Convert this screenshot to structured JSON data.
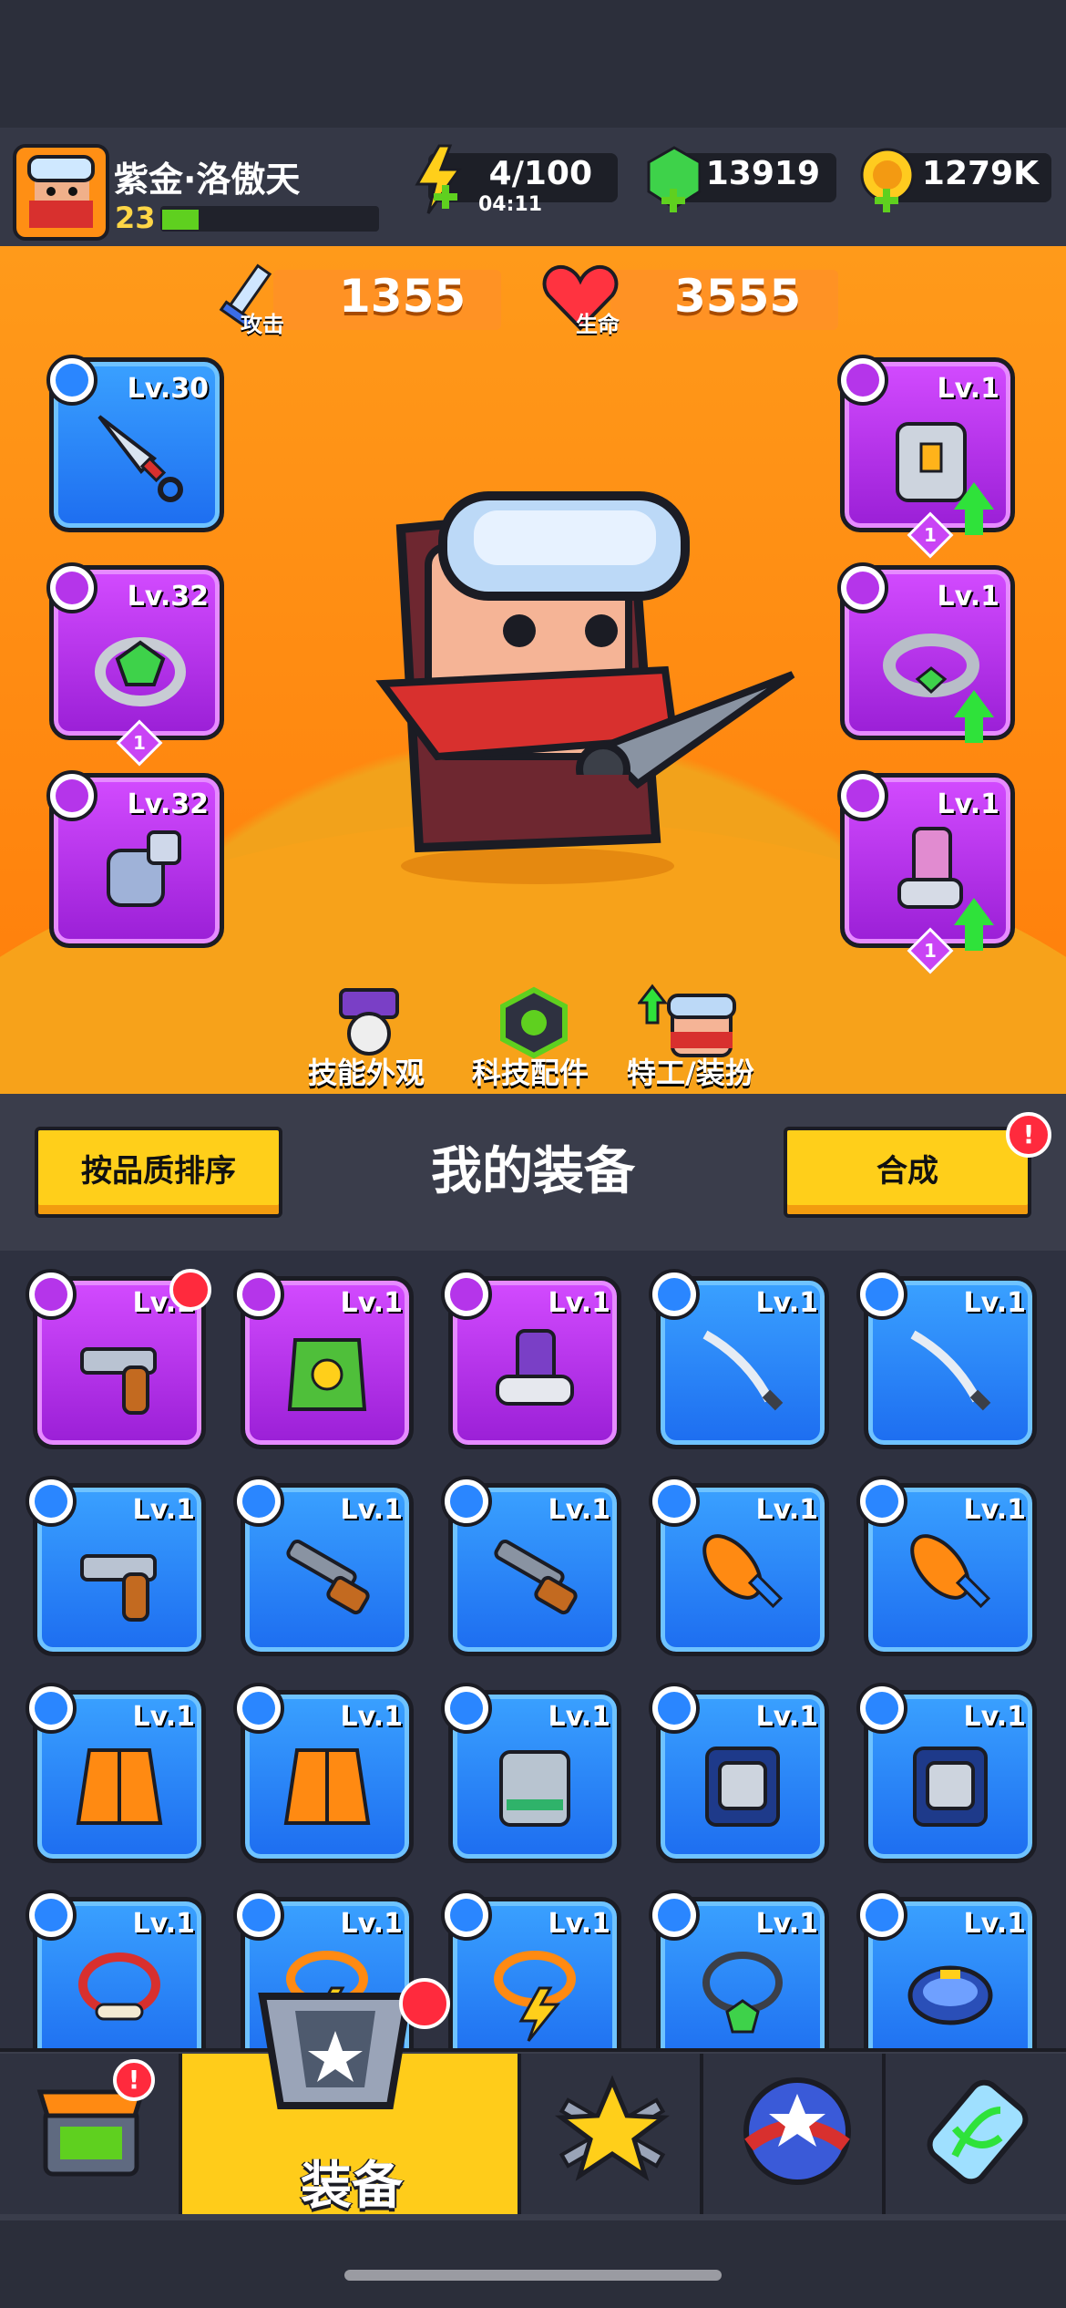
{
  "player": {
    "name": "紫金·洛傲天",
    "level": "23",
    "xp_fraction": 0.17
  },
  "resources": {
    "energy": {
      "value": "4/100",
      "timer": "04:11"
    },
    "gems": {
      "value": "13919"
    },
    "coins": {
      "value": "1279K"
    }
  },
  "stats": {
    "attack": {
      "label": "攻击",
      "value": "1355"
    },
    "hp": {
      "label": "生命",
      "value": "3555"
    }
  },
  "equipped": {
    "left": [
      {
        "level": "Lv.30",
        "rarity": "blue",
        "item": "kunai-icon",
        "badge": "weapon-badge-icon"
      },
      {
        "level": "Lv.32",
        "rarity": "purple",
        "item": "ring-icon",
        "badge": "ring-badge-icon",
        "stars": "1"
      },
      {
        "level": "Lv.32",
        "rarity": "purple",
        "item": "glove-icon",
        "badge": "glove-badge-icon"
      }
    ],
    "right": [
      {
        "level": "Lv.1",
        "rarity": "purple",
        "item": "armor-icon",
        "badge": "armor-badge-icon",
        "stars": "1",
        "upgrade": true
      },
      {
        "level": "Lv.1",
        "rarity": "purple",
        "item": "belt-icon",
        "badge": "belt-badge-icon",
        "upgrade": true
      },
      {
        "level": "Lv.1",
        "rarity": "purple",
        "item": "boots-icon",
        "badge": "boots-badge-icon",
        "stars": "1",
        "upgrade": true
      }
    ]
  },
  "hero_tabs": [
    {
      "label": "技能外观",
      "icon": "skin-icon"
    },
    {
      "label": "科技配件",
      "icon": "tech-icon"
    },
    {
      "label": "特工/装扮",
      "icon": "agent-icon"
    }
  ],
  "panel": {
    "title": "我的装备",
    "sort_label": "按品质排序",
    "merge_label": "合成",
    "merge_alert": "!"
  },
  "inventory": [
    {
      "level": "Lv.1",
      "rarity": "purple",
      "item": "revolver-icon",
      "badge": "weapon-badge-icon",
      "alert": true
    },
    {
      "level": "Lv.1",
      "rarity": "purple",
      "item": "vest-icon",
      "badge": "armor-badge-icon"
    },
    {
      "level": "Lv.1",
      "rarity": "purple",
      "item": "sneaker-icon",
      "badge": "boots-badge-icon"
    },
    {
      "level": "Lv.1",
      "rarity": "blue",
      "item": "katana-icon",
      "badge": "weapon-badge-icon"
    },
    {
      "level": "Lv.1",
      "rarity": "blue",
      "item": "katana-icon",
      "badge": "weapon-badge-icon"
    },
    {
      "level": "Lv.1",
      "rarity": "blue",
      "item": "revolver-icon",
      "badge": "weapon-badge-icon"
    },
    {
      "level": "Lv.1",
      "rarity": "blue",
      "item": "shotgun-icon",
      "badge": "weapon-badge-icon"
    },
    {
      "level": "Lv.1",
      "rarity": "blue",
      "item": "shotgun-icon",
      "badge": "weapon-badge-icon"
    },
    {
      "level": "Lv.1",
      "rarity": "blue",
      "item": "bat-icon",
      "badge": "weapon-badge-icon"
    },
    {
      "level": "Lv.1",
      "rarity": "blue",
      "item": "bat-icon",
      "badge": "weapon-badge-icon"
    },
    {
      "level": "Lv.1",
      "rarity": "blue",
      "item": "jacket-icon",
      "badge": "armor-badge-icon"
    },
    {
      "level": "Lv.1",
      "rarity": "blue",
      "item": "jacket-icon",
      "badge": "armor-badge-icon"
    },
    {
      "level": "Lv.1",
      "rarity": "blue",
      "item": "chest-armor-icon",
      "badge": "armor-badge-icon"
    },
    {
      "level": "Lv.1",
      "rarity": "blue",
      "item": "heavy-armor-icon",
      "badge": "armor-badge-icon"
    },
    {
      "level": "Lv.1",
      "rarity": "blue",
      "item": "heavy-armor-icon",
      "badge": "armor-badge-icon"
    },
    {
      "level": "Lv.1",
      "rarity": "blue",
      "item": "bone-necklace-icon",
      "badge": "ring-badge-icon"
    },
    {
      "level": "Lv.1",
      "rarity": "blue",
      "item": "bolt-necklace-icon",
      "badge": "ring-badge-icon"
    },
    {
      "level": "Lv.1",
      "rarity": "blue",
      "item": "bolt-necklace-icon",
      "badge": "ring-badge-icon"
    },
    {
      "level": "Lv.1",
      "rarity": "blue",
      "item": "gem-necklace-icon",
      "badge": "ring-badge-icon"
    },
    {
      "level": "Lv.1",
      "rarity": "blue",
      "item": "bracelet-icon",
      "badge": "ring-badge-icon"
    }
  ],
  "bottom_nav": [
    {
      "name": "shop-tab",
      "icon": "shop-icon",
      "alert": "!"
    },
    {
      "name": "equipment-tab",
      "icon": "equipment-icon",
      "label": "装备",
      "active": true
    },
    {
      "name": "battle-tab",
      "icon": "crossed-swords-star-icon"
    },
    {
      "name": "talent-tab",
      "icon": "star-orb-icon"
    },
    {
      "name": "dna-tab",
      "icon": "dna-capsule-icon"
    }
  ],
  "colors": {
    "accent_orange": "#ff8a12",
    "rare_blue": "#2a86ff",
    "epic_purple": "#b535ea",
    "button_yellow": "#ffcf1a",
    "alert_red": "#ff2a3d"
  }
}
